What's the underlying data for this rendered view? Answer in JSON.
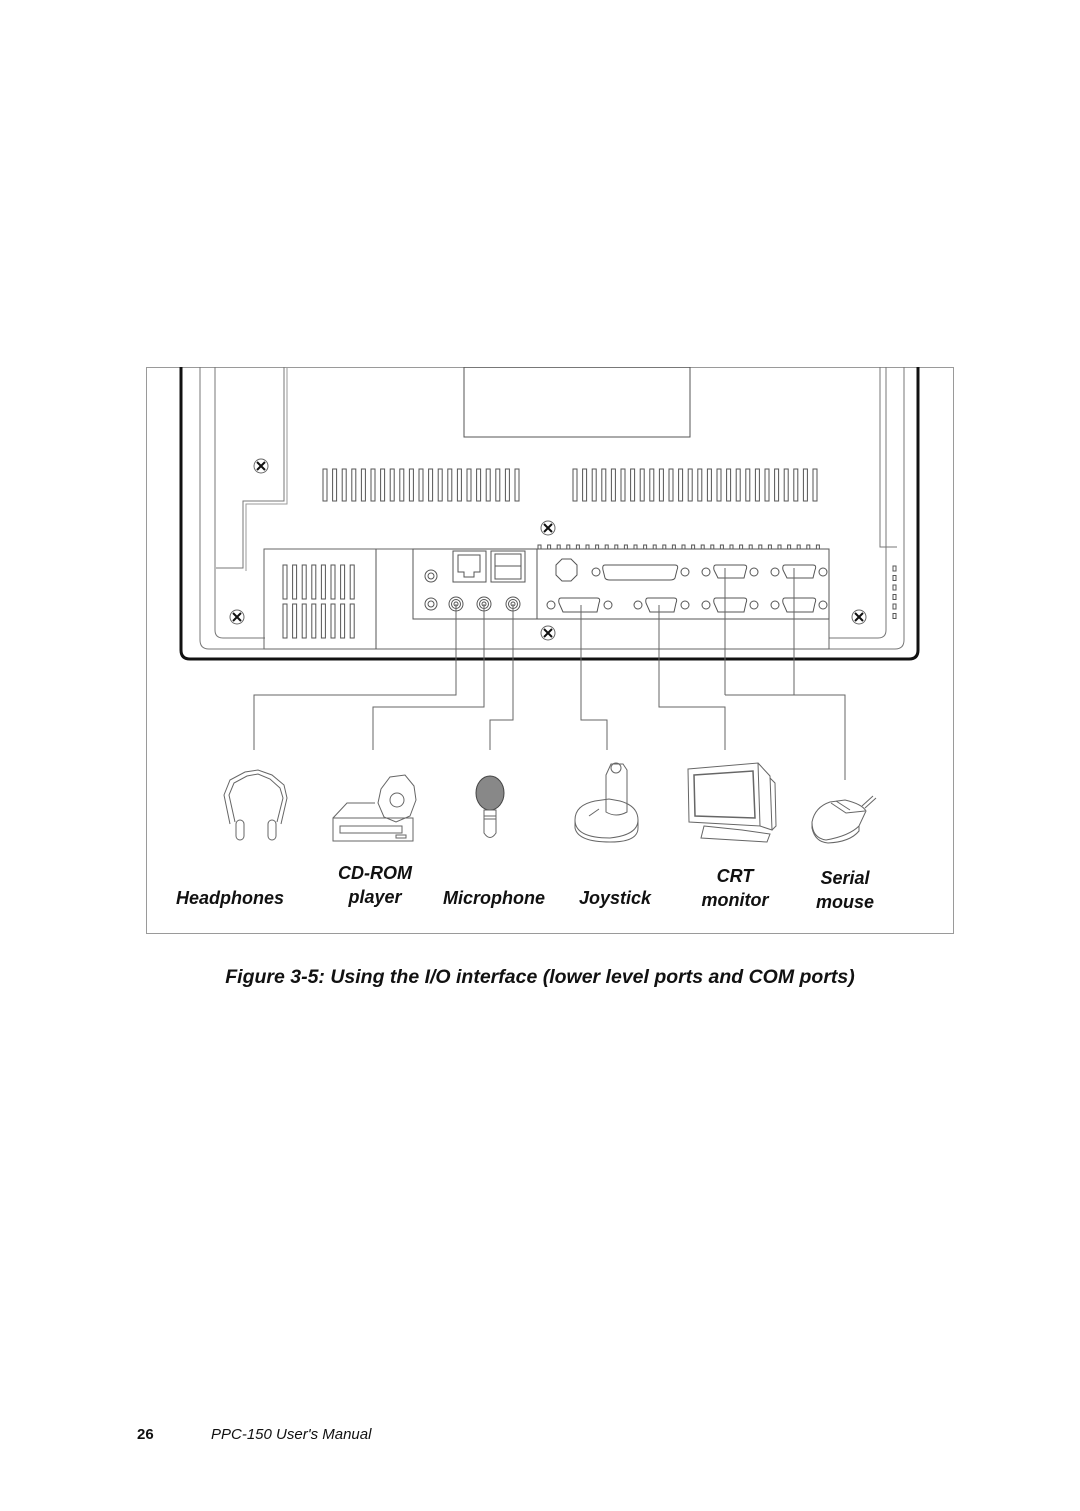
{
  "figure": {
    "caption": "Figure 3-5: Using the I/O interface (lower level ports and COM ports)",
    "devices": [
      {
        "id": "headphones",
        "icon": "headphones-icon",
        "label_lines": [
          "Headphones"
        ]
      },
      {
        "id": "cdrom",
        "icon": "cdrom-player-icon",
        "label_lines": [
          "CD-ROM",
          "player"
        ]
      },
      {
        "id": "microphone",
        "icon": "microphone-icon",
        "label_lines": [
          "Microphone"
        ]
      },
      {
        "id": "joystick",
        "icon": "joystick-icon",
        "label_lines": [
          "Joystick"
        ]
      },
      {
        "id": "crt",
        "icon": "crt-monitor-icon",
        "label_lines": [
          "CRT",
          "monitor"
        ]
      },
      {
        "id": "mouse",
        "icon": "serial-mouse-icon",
        "label_lines": [
          "Serial",
          "mouse"
        ]
      }
    ]
  },
  "footer": {
    "page_number": "26",
    "manual_title": "PPC-150 User's Manual"
  }
}
